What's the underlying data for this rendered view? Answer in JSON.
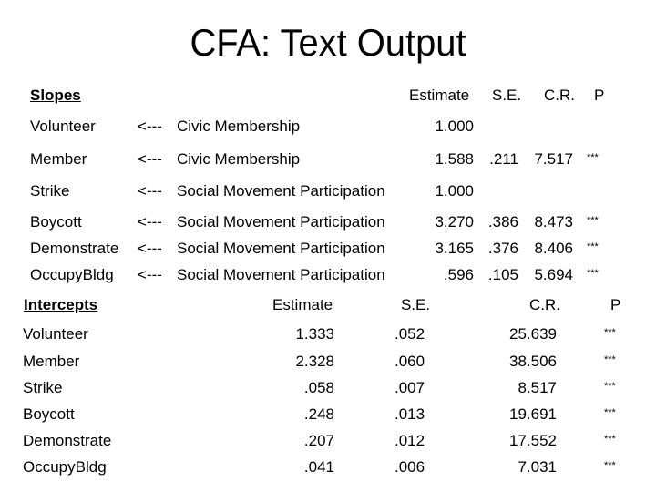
{
  "title": "CFA:  Text Output",
  "slopes": {
    "heading": "Slopes",
    "columns": [
      "Estimate",
      "S.E.",
      "C.R.",
      "P"
    ],
    "rows": [
      {
        "dv": "Volunteer",
        "arrow": "<---",
        "factor": "Civic Membership",
        "estimate": "1.000",
        "se": "",
        "cr": "",
        "p": ""
      },
      {
        "dv": "Member",
        "arrow": "<---",
        "factor": "Civic Membership",
        "estimate": "1.588",
        "se": ".211",
        "cr": "7.517",
        "p": "***"
      },
      {
        "dv": "Strike",
        "arrow": "<---",
        "factor": "Social Movement Participation",
        "estimate": "1.000",
        "se": "",
        "cr": "",
        "p": ""
      },
      {
        "dv": "Boycott",
        "arrow": "<---",
        "factor": "Social Movement Participation",
        "estimate": "3.270",
        "se": ".386",
        "cr": "8.473",
        "p": "***"
      },
      {
        "dv": "Demonstrate",
        "arrow": "<---",
        "factor": "Social Movement Participation",
        "estimate": "3.165",
        "se": ".376",
        "cr": "8.406",
        "p": "***"
      },
      {
        "dv": "OccupyBldg",
        "arrow": "<---",
        "factor": "Social Movement Participation",
        "estimate": ".596",
        "se": ".105",
        "cr": "5.694",
        "p": "***"
      }
    ]
  },
  "intercepts": {
    "heading": "Intercepts",
    "columns": [
      "Estimate",
      "S.E.",
      "C.R.",
      "P"
    ],
    "rows": [
      {
        "var": "Volunteer",
        "estimate": "1.333",
        "se": ".052",
        "cr": "25.639",
        "p": "***"
      },
      {
        "var": "Member",
        "estimate": "2.328",
        "se": ".060",
        "cr": "38.506",
        "p": "***"
      },
      {
        "var": "Strike",
        "estimate": ".058",
        "se": ".007",
        "cr": "8.517",
        "p": "***"
      },
      {
        "var": "Boycott",
        "estimate": ".248",
        "se": ".013",
        "cr": "19.691",
        "p": "***"
      },
      {
        "var": "Demonstrate",
        "estimate": ".207",
        "se": ".012",
        "cr": "17.552",
        "p": "***"
      },
      {
        "var": "OccupyBldg",
        "estimate": ".041",
        "se": ".006",
        "cr": "7.031",
        "p": "***"
      }
    ]
  }
}
